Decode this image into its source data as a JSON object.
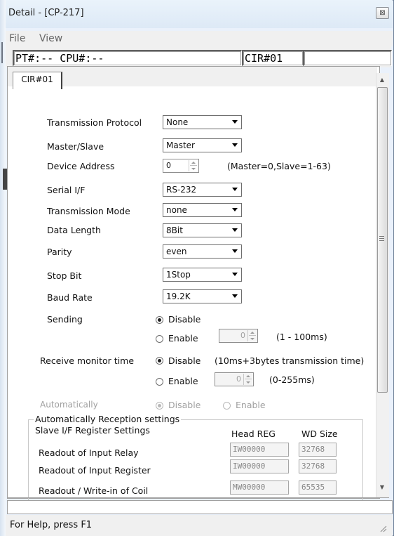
{
  "window": {
    "title": "Detail - [CP-217]",
    "close_glyph": "⊠"
  },
  "menu": [
    "File",
    "View"
  ],
  "status": {
    "pt_cpu": "PT#:-- CPU#:--",
    "cir": "CIR#01",
    "extra": ""
  },
  "tab": "CIR#01",
  "form": {
    "transmission_protocol": {
      "label": "Transmission Protocol",
      "value": "None"
    },
    "master_slave": {
      "label": "Master/Slave",
      "value": "Master"
    },
    "device_address": {
      "label": "Device Address",
      "value": "0",
      "hint": "(Master=0,Slave=1-63)"
    },
    "serial_if": {
      "label": "Serial I/F",
      "value": "RS-232"
    },
    "transmission_mode": {
      "label": "Transmission Mode",
      "value": "none"
    },
    "data_length": {
      "label": "Data Length",
      "value": "8Bit"
    },
    "parity": {
      "label": "Parity",
      "value": "even"
    },
    "stop_bit": {
      "label": "Stop Bit",
      "value": "1Stop"
    },
    "baud_rate": {
      "label": "Baud Rate",
      "value": "19.2K"
    },
    "sending": {
      "label": "Sending",
      "disable": "Disable",
      "enable": "Enable",
      "selected": "Disable",
      "value": "0",
      "range": "(1 - 100ms)"
    },
    "receive_monitor": {
      "label": "Receive monitor time",
      "disable": "Disable",
      "enable": "Enable",
      "selected": "Disable",
      "note": "(10ms+3bytes transmission time)",
      "value": "0",
      "range": "(0-255ms)"
    },
    "automatically": {
      "label": "Automatically",
      "disable": "Disable",
      "enable": "Enable",
      "selected": "Disable"
    }
  },
  "group": {
    "title": "Automatically Reception settings",
    "subtitle": "Slave I/F Register Settings",
    "head_reg": "Head REG",
    "wd_size": "WD Size",
    "rows": [
      {
        "label": "Readout of Input Relay",
        "reg": "IW00000",
        "size": "32768"
      },
      {
        "label": "Readout of Input Register",
        "reg": "IW00000",
        "size": "32768"
      },
      {
        "label": "Readout / Write-in of Coil",
        "reg": "MW00000",
        "size": "65535"
      }
    ]
  },
  "statusbar": {
    "help": "For Help, press F1"
  },
  "icons": [
    "close-icon",
    "dropdown-arrow-icon",
    "spin-up-icon",
    "spin-down-icon",
    "scroll-up-icon",
    "scroll-down-icon",
    "resize-grip-icon"
  ]
}
